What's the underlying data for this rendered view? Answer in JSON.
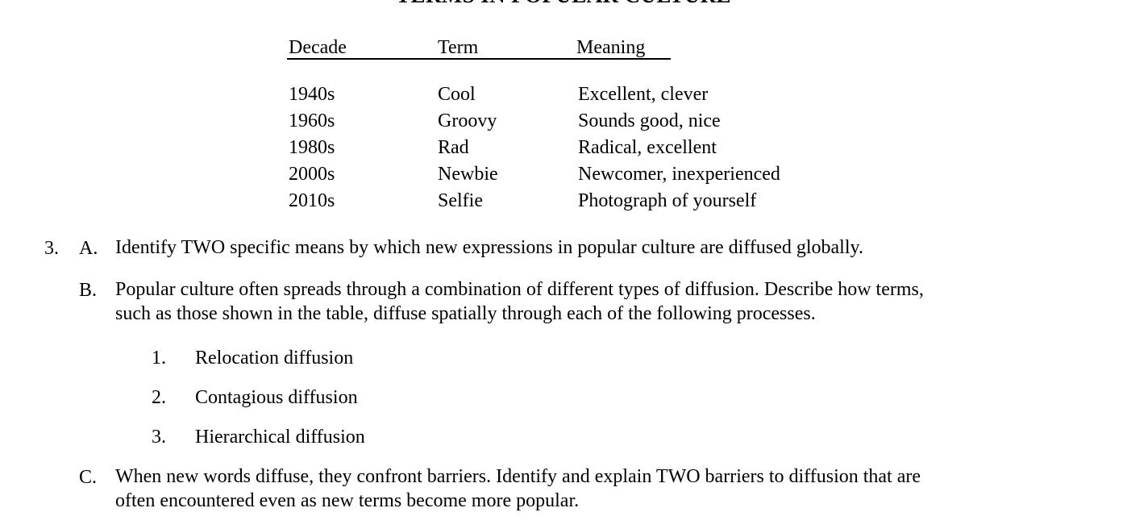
{
  "document": {
    "title": "TERMS IN POPULAR CULTURE"
  },
  "table": {
    "headers": {
      "decade": "Decade",
      "term": "Term",
      "meaning": "Meaning"
    },
    "rows": [
      {
        "decade": "1940s",
        "term": "Cool",
        "meaning": "Excellent, clever"
      },
      {
        "decade": "1960s",
        "term": "Groovy",
        "meaning": "Sounds good, nice"
      },
      {
        "decade": "1980s",
        "term": "Rad",
        "meaning": "Radical, excellent"
      },
      {
        "decade": "2000s",
        "term": "Newbie",
        "meaning": "Newcomer, inexperienced"
      },
      {
        "decade": "2010s",
        "term": "Selfie",
        "meaning": "Photograph of yourself"
      }
    ]
  },
  "question": {
    "number": "3.",
    "parts": {
      "a": {
        "label": "A.",
        "line1": "Identify TWO specific means by which new expressions in popular culture are diffused globally."
      },
      "b": {
        "label": "B.",
        "line1": "Popular culture often spreads through a combination of different types of diffusion. Describe how terms,",
        "line2": "such as those shown in the table, diffuse spatially through each of the following processes."
      },
      "c": {
        "label": "C.",
        "line1": "When new words diffuse, they confront barriers. Identify and explain TWO barriers to diffusion that are",
        "line2": "often encountered even as new terms become more popular."
      }
    },
    "sub_items": [
      {
        "number": "1.",
        "text": "Relocation diffusion"
      },
      {
        "number": "2.",
        "text": "Contagious diffusion"
      },
      {
        "number": "3.",
        "text": "Hierarchical diffusion"
      }
    ]
  }
}
